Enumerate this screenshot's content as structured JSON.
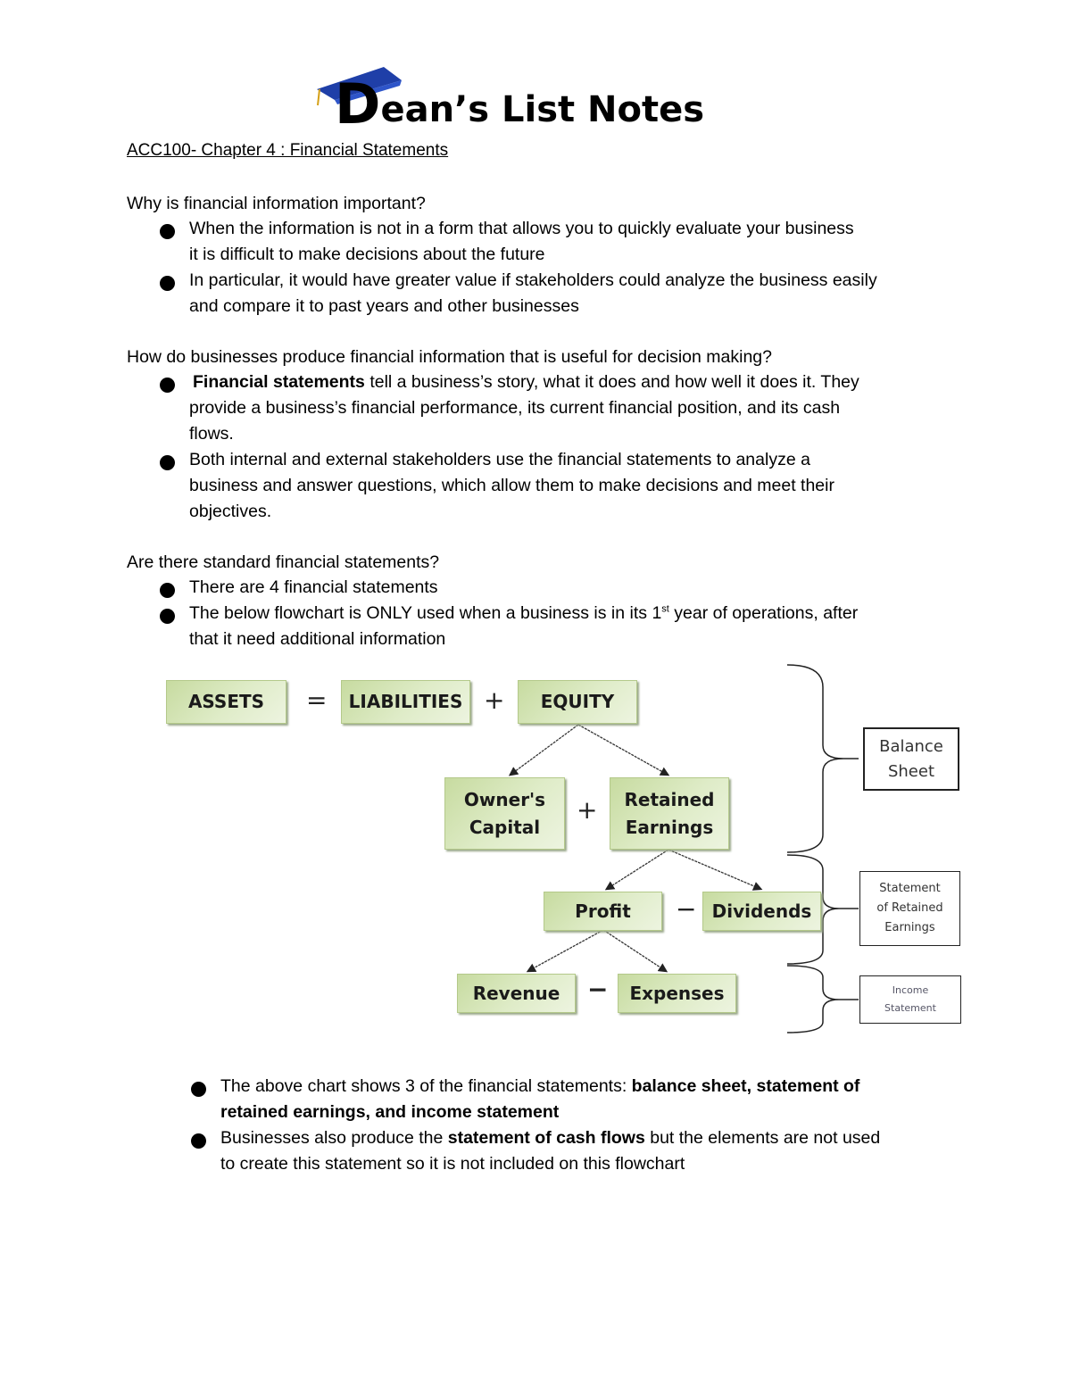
{
  "logo": {
    "text_first": "D",
    "text_rest": "ean’s List Notes",
    "icon": "graduation-cap-icon"
  },
  "title": "ACC100- Chapter 4 : Financial Statements",
  "sections": [
    {
      "question": "Why is financial information important?",
      "bullets": [
        {
          "lines": [
            "When the information is not in a form that allows you to quickly evaluate your business",
            "it is difficult to make decisions about the future"
          ]
        },
        {
          "lines": [
            "In particular, it would have greater value if stakeholders could analyze the business easily",
            "and compare it to past years and other businesses"
          ]
        }
      ]
    },
    {
      "question": "How do businesses produce financial information that is useful for decision making?",
      "bullets": [
        {
          "bold_lead": "Financial statements",
          "lines": [
            " tell a business’s story, what it does and how well it does it.  They",
            "provide a business’s financial performance, its current financial position, and its cash",
            "flows."
          ]
        },
        {
          "lines": [
            "Both internal and external stakeholders use the financial statements to analyze a",
            "business and answer questions, which allow them to make decisions and meet their",
            "objectives."
          ]
        }
      ]
    },
    {
      "question": "Are there standard financial statements?",
      "bullets": [
        {
          "lines": [
            "There are 4 financial statements"
          ]
        },
        {
          "lines_pre": "The below flowchart is ONLY used when a business is in its 1",
          "sup": "st",
          "lines_post": " year of operations, after",
          "line2": "that it need additional information"
        }
      ]
    }
  ],
  "flowchart": {
    "nodes": {
      "assets": "ASSETS",
      "liabilities": "LIABILITIES",
      "equity": "EQUITY",
      "owners_capital": [
        "Owner's",
        "Capital"
      ],
      "retained_earnings": [
        "Retained",
        "Earnings"
      ],
      "profit": "Profit",
      "dividends": "Dividends",
      "revenue": "Revenue",
      "expenses": "Expenses"
    },
    "operators": {
      "eq": "=",
      "plus1": "+",
      "plus2": "+",
      "minus1": "−",
      "minus2": "−"
    },
    "statements": {
      "balance_sheet": [
        "Balance",
        "Sheet"
      ],
      "retained_earnings_stmt": [
        "Statement",
        "of Retained",
        "Earnings"
      ],
      "income_statement": [
        "Income",
        "Statement"
      ]
    }
  },
  "closing_bullets": [
    {
      "pre": "The above chart shows 3 of the financial statements:  ",
      "bold": "balance sheet, statement of",
      "line2_bold": "retained earnings, and income statement"
    },
    {
      "pre": "Businesses also produce the ",
      "bold": "statement of cash flows",
      "post": " but the elements are not used",
      "line2": "to create this statement so it is not included on this flowchart"
    }
  ]
}
